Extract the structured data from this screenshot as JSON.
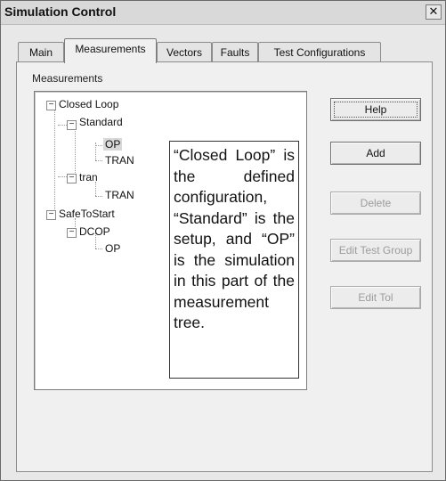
{
  "window": {
    "title": "Simulation Control",
    "close_label": "✕"
  },
  "tabs": [
    {
      "label": "Main"
    },
    {
      "label": "Measurements"
    },
    {
      "label": "Vectors"
    },
    {
      "label": "Faults"
    },
    {
      "label": "Test Configurations"
    }
  ],
  "panel": {
    "section_label": "Measurements"
  },
  "tree": {
    "nodes": [
      {
        "label": "Closed Loop",
        "expander": "−"
      },
      {
        "label": "Standard",
        "expander": "−"
      },
      {
        "label": "OP"
      },
      {
        "label": "TRAN"
      },
      {
        "label": "tran",
        "expander": "−"
      },
      {
        "label": "TRAN"
      },
      {
        "label": "SafeToStart",
        "expander": "−"
      },
      {
        "label": "DCOP",
        "expander": "−"
      },
      {
        "label": "OP"
      }
    ]
  },
  "callout": {
    "text": "“Closed Loop” is the defined configuration, “Standard” is the setup, and “OP” is the simulation in this part of the measurement tree."
  },
  "buttons": {
    "help": "Help",
    "add": "Add",
    "delete": "Delete",
    "edit_test_group": "Edit Test Group",
    "edit_tol": "Edit Tol"
  }
}
